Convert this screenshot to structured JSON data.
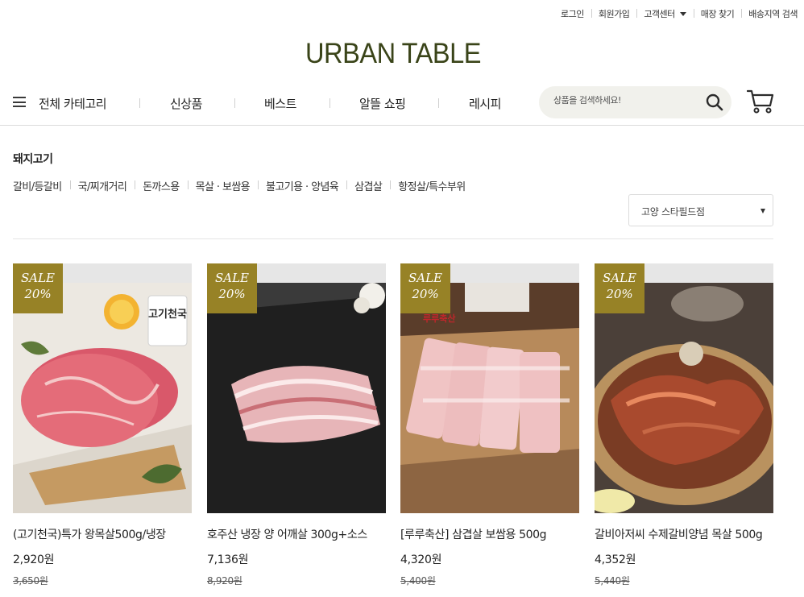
{
  "util_links": [
    {
      "label": "로그인"
    },
    {
      "label": "회원가입"
    },
    {
      "label": "고객센터",
      "dropdown": true
    },
    {
      "label": "매장 찾기"
    },
    {
      "label": "배송지역 검색"
    }
  ],
  "logo": "URBAN TABLE",
  "nav": {
    "all_category": "전체 카테고리",
    "menus": [
      "신상품",
      "베스트",
      "알뜰 쇼핑",
      "레시피"
    ]
  },
  "search": {
    "placeholder": "상품을 검색하세요!"
  },
  "category": {
    "title": "돼지고기",
    "subcategories": [
      "갈비/등갈비",
      "국/찌개거리",
      "돈까스용",
      "목살 · 보쌈용",
      "불고기용 · 양념육",
      "삼겹살",
      "항정살/특수부위"
    ]
  },
  "store_select": {
    "value": "고양 스타필드점"
  },
  "products": [
    {
      "sale_label": "SALE",
      "discount": "20%",
      "name": "(고기천국)특가 왕목살500g/냉장",
      "price": "2,920원",
      "original_price": "3,650원",
      "image_text": "고기천국"
    },
    {
      "sale_label": "SALE",
      "discount": "20%",
      "name": "호주산 냉장 양 어깨살 300g+소스",
      "price": "7,136원",
      "original_price": "8,920원"
    },
    {
      "sale_label": "SALE",
      "discount": "20%",
      "name": "[루루축산] 삼겹살 보쌈용 500g",
      "price": "4,320원",
      "original_price": "5,400원",
      "image_text": "루루축산"
    },
    {
      "sale_label": "SALE",
      "discount": "20%",
      "name": "갈비아저씨 수제갈비양념 목살 500g",
      "price": "4,352원",
      "original_price": "5,440원"
    }
  ],
  "colors": {
    "accent": "#978226",
    "logo": "#3a4419",
    "search_bg": "#f1f1ec"
  }
}
